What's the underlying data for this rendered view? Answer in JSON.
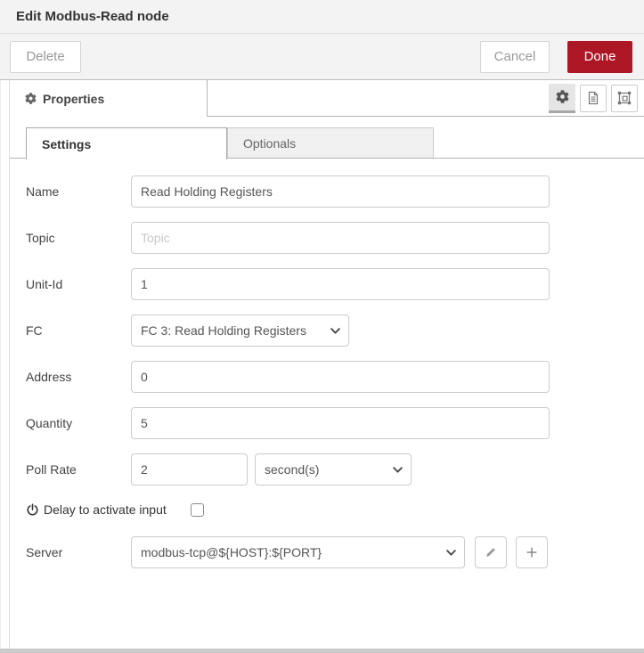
{
  "dialog": {
    "title": "Edit Modbus-Read node"
  },
  "toolbar": {
    "delete_label": "Delete",
    "cancel_label": "Cancel",
    "done_label": "Done"
  },
  "tabs": {
    "properties_label": "Properties"
  },
  "subtabs": [
    {
      "label": "Settings",
      "active": true
    },
    {
      "label": "Optionals",
      "active": false
    }
  ],
  "form": {
    "name": {
      "label": "Name",
      "value": "Read Holding Registers"
    },
    "topic": {
      "label": "Topic",
      "value": "",
      "placeholder": "Topic"
    },
    "unit_id": {
      "label": "Unit-Id",
      "value": "1"
    },
    "fc": {
      "label": "FC",
      "value": "FC 3: Read Holding Registers"
    },
    "address": {
      "label": "Address",
      "value": "0"
    },
    "quantity": {
      "label": "Quantity",
      "value": "5"
    },
    "poll_rate": {
      "label": "Poll Rate",
      "value": "2",
      "unit_selected": "second(s)"
    },
    "delay": {
      "label": "Delay to activate input",
      "checked": false
    },
    "server": {
      "label": "Server",
      "value": "modbus-tcp@${HOST}:${PORT}"
    }
  },
  "icons": {
    "properties_tab": "gear-icon",
    "header_buttons": [
      "gear-icon",
      "file-icon",
      "appearance-icon"
    ],
    "delay_row": "power-icon",
    "server_edit": "pencil-icon",
    "server_add": "plus-icon",
    "selects": "chevron-down-icon"
  },
  "colors": {
    "done_button": "#AD1625",
    "header_bg": "#f3f3f3",
    "border_light": "#dddddd",
    "border_medium": "#bbbbbb",
    "active_icon_button_bg": "#e5e5e5",
    "inactive_tab_bg": "#f0f0f0"
  }
}
